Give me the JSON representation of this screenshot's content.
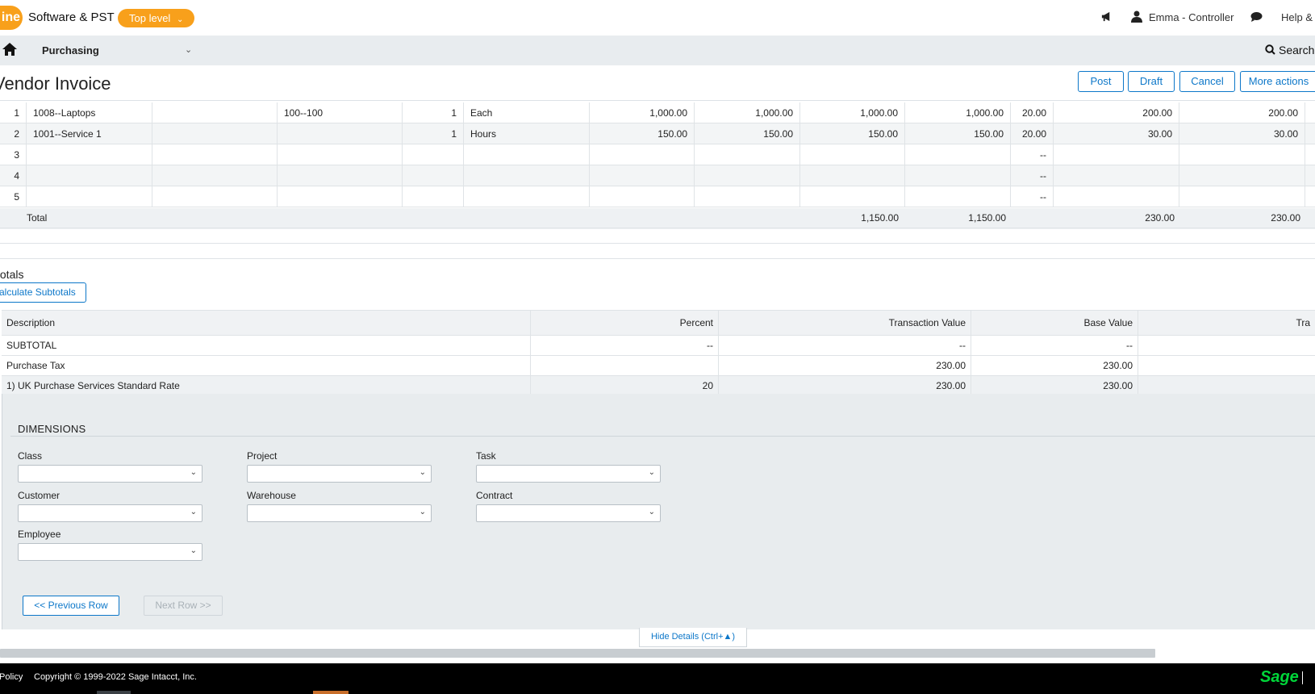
{
  "topbar": {
    "logo_text": "ine",
    "company": "Software & PST",
    "level": "Top level",
    "notifications_icon": "megaphone-icon",
    "user": "Emma - Controller",
    "chat_icon": "chat-bubble-icon",
    "help": "Help &"
  },
  "nav": {
    "home_icon": "home-icon",
    "module": "Purchasing",
    "search": "Search"
  },
  "page": {
    "title": "Vendor Invoice",
    "actions": {
      "post": "Post",
      "draft": "Draft",
      "cancel": "Cancel",
      "more": "More actions"
    }
  },
  "lines": {
    "rows": [
      {
        "num": "1",
        "item": "1008--Laptops",
        "dept": "100--100",
        "qty": "1",
        "unit": "Each",
        "price": "1,000.00",
        "c1": "1,000.00",
        "c2": "1,000.00",
        "c3": "1,000.00",
        "rate": "20.00",
        "tax1": "200.00",
        "tax2": "200.00"
      },
      {
        "num": "2",
        "item": "1001--Service 1",
        "dept": "",
        "qty": "1",
        "unit": "Hours",
        "price": "150.00",
        "c1": "150.00",
        "c2": "150.00",
        "c3": "150.00",
        "rate": "20.00",
        "tax1": "30.00",
        "tax2": "30.00"
      },
      {
        "num": "3",
        "item": "",
        "dept": "",
        "qty": "",
        "unit": "",
        "price": "",
        "c1": "",
        "c2": "",
        "c3": "",
        "rate": "--",
        "tax1": "",
        "tax2": ""
      },
      {
        "num": "4",
        "item": "",
        "dept": "",
        "qty": "",
        "unit": "",
        "price": "",
        "c1": "",
        "c2": "",
        "c3": "",
        "rate": "--",
        "tax1": "",
        "tax2": ""
      },
      {
        "num": "5",
        "item": "",
        "dept": "",
        "qty": "",
        "unit": "",
        "price": "",
        "c1": "",
        "c2": "",
        "c3": "",
        "rate": "--",
        "tax1": "",
        "tax2": ""
      }
    ],
    "total": {
      "label": "Total",
      "c2": "1,150.00",
      "c3": "1,150.00",
      "tax1": "230.00",
      "tax2": "230.00"
    }
  },
  "subtotals": {
    "title": "totals",
    "calc_button": "alculate Subtotals",
    "headers": {
      "description": "Description",
      "percent": "Percent",
      "transaction_value": "Transaction Value",
      "base_value": "Base Value",
      "extra": "Tra"
    },
    "rows": [
      {
        "description": "SUBTOTAL",
        "percent": "--",
        "transaction_value": "--",
        "base_value": "--"
      },
      {
        "description": "Purchase Tax",
        "percent": "",
        "transaction_value": "230.00",
        "base_value": "230.00"
      },
      {
        "description": "1) UK Purchase Services Standard Rate",
        "percent": "20",
        "transaction_value": "230.00",
        "base_value": "230.00"
      }
    ]
  },
  "dimensions": {
    "title": "DIMENSIONS",
    "fields": {
      "class": "Class",
      "project": "Project",
      "task": "Task",
      "customer": "Customer",
      "warehouse": "Warehouse",
      "contract": "Contract",
      "employee": "Employee"
    },
    "prev_row": "<< Previous Row",
    "next_row": "Next Row >>",
    "hide_details": "Hide Details (Ctrl+▲)"
  },
  "footer": {
    "policy": "Policy",
    "copyright": "Copyright © 1999-2022 Sage Intacct, Inc.",
    "brand": "Sage"
  }
}
